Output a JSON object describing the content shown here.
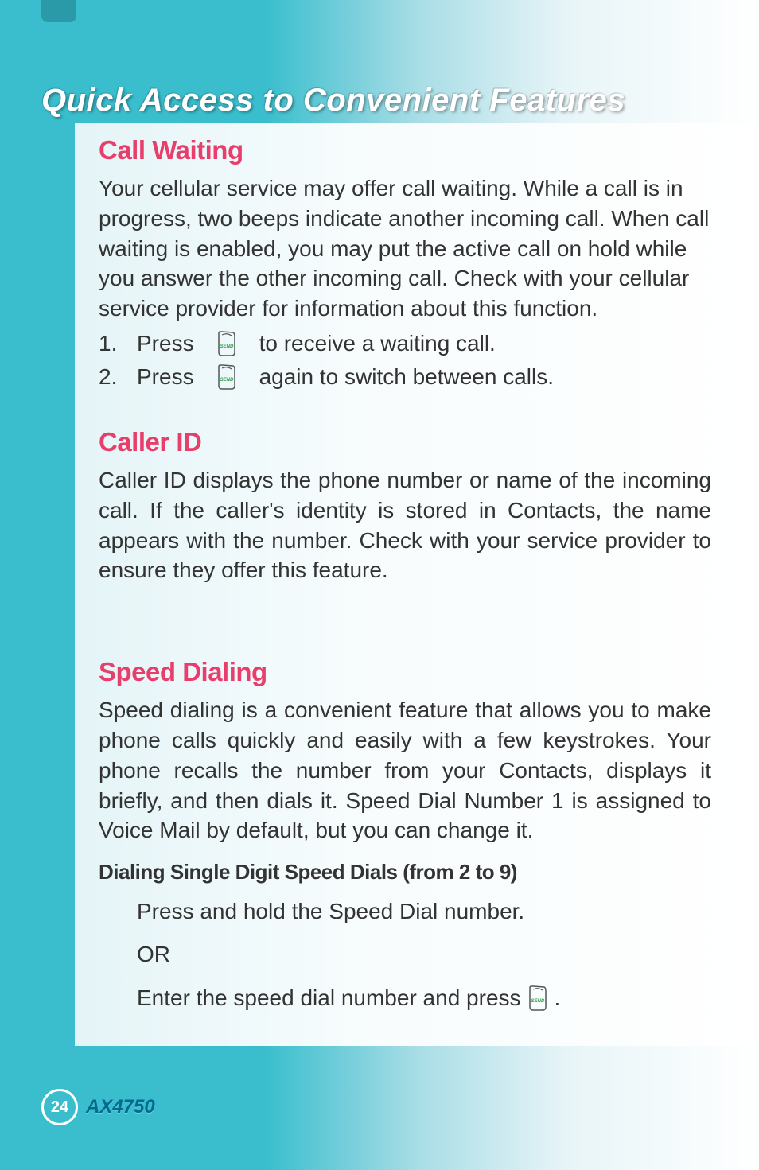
{
  "page": {
    "title": "Quick Access to Convenient Features",
    "number": "24",
    "model": "AX4750"
  },
  "sections": {
    "call_waiting": {
      "heading": "Call Waiting",
      "body": "Your cellular service may offer call waiting. While a call is in progress, two beeps indicate another incoming call. When call waiting is enabled, you may put the active call on hold while you answer the other incoming call. Check with your cellular service provider for information about this function.",
      "steps": [
        {
          "num": "1.",
          "pre": "Press",
          "post": "to receive a waiting call."
        },
        {
          "num": "2.",
          "pre": "Press",
          "post": "again to switch between calls."
        }
      ]
    },
    "caller_id": {
      "heading": "Caller ID",
      "body": "Caller ID displays the phone number or name of the incoming call. If the caller's identity is stored in Contacts, the name appears with the number. Check with your service provider to ensure they offer this feature."
    },
    "speed_dialing": {
      "heading": "Speed Dialing",
      "body": "Speed dialing is a convenient feature that allows you to make phone calls quickly and easily with a few keystrokes. Your phone recalls the number from your Contacts, displays it briefly, and then dials it. Speed Dial Number 1 is assigned to Voice Mail by default, but you can change it.",
      "sub_heading": "Dialing Single Digit Speed Dials (from 2 to 9)",
      "line1": "Press and hold the Speed Dial number.",
      "or": "OR",
      "line2_pre": "Enter the speed dial number and press",
      "line2_post": "."
    }
  }
}
